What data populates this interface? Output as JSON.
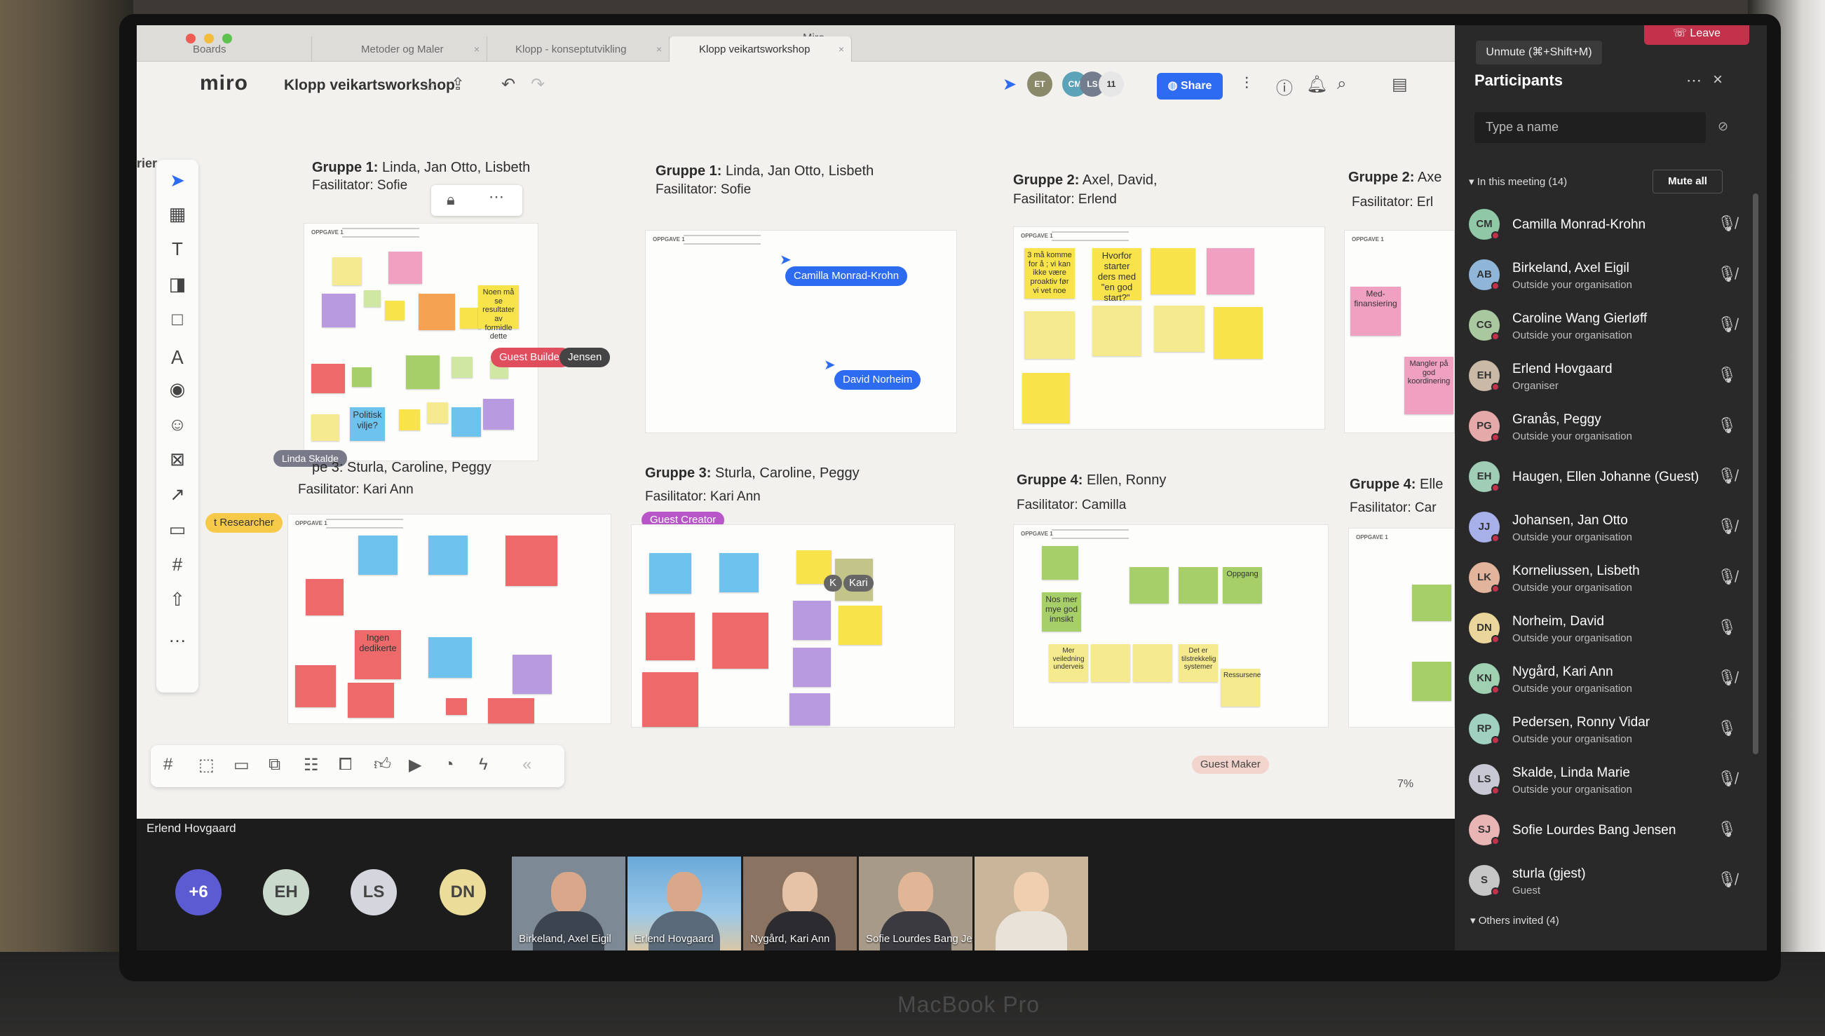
{
  "tabs": [
    "Boards",
    "Metoder og Maler",
    "Klopp - konseptutvikling",
    "Klopp veikartsworkshop"
  ],
  "window_title": "Miro",
  "miro": {
    "logo": "miro",
    "board_name": "Klopp veikartsworkshop",
    "avatars": [
      "ET",
      "CM",
      "LS",
      "11"
    ],
    "share_label": "Share",
    "zoom": "7%",
    "side_label": "rier"
  },
  "groups": [
    {
      "title_bold": "Gruppe 1:",
      "title_rest": " Linda, Jan Otto, Lisbeth",
      "fas": "Fasilitator: Sofie"
    },
    {
      "title_bold": "Gruppe 1:",
      "title_rest": " Linda, Jan Otto, Lisbeth",
      "fas": "Fasilitator: Sofie"
    },
    {
      "title_bold": "Gruppe 2:",
      "title_rest": " Axel, David,",
      "fas": "Fasilitator: Erlend"
    },
    {
      "title_bold": "Gruppe 2:",
      "title_rest": " Axe",
      "fas": "Fasilitator: Erl"
    },
    {
      "title_bold": "",
      "title_rest": "pe 3: Sturla, Caroline, Peggy",
      "fas": "Fasilitator: Kari Ann"
    },
    {
      "title_bold": "Gruppe 3:",
      "title_rest": " Sturla, Caroline, Peggy",
      "fas": "Fasilitator: Kari Ann"
    },
    {
      "title_bold": "Gruppe 4:",
      "title_rest": " Ellen, Ronny",
      "fas": "Fasilitator: Camilla"
    },
    {
      "title_bold": "Gruppe 4:",
      "title_rest": " Elle",
      "fas": "Fasilitator: Car"
    }
  ],
  "frame_tag": "OPPGAVE 1",
  "notes": {
    "politisk": "Politisk vilje?",
    "nosen": "Noen må se resultater av formidle dette",
    "hvorfor": "Hvorfor starter ders med \"en god start?\"",
    "tre_maa": "3 må komme for å ; vi kan ikke være proaktiv før vi vet noe",
    "med": "Med-finansiering",
    "mangler": "Mangler på god koordinering",
    "ingen": "Ingen dedikerte",
    "nos_mer": "Nos mer mye god innsikt",
    "mer": "Mer veiledning underveis",
    "oppgang": "Oppgang",
    "det_er": "Det er tilstrekkelig systemer",
    "ressurser": "Ressursene"
  },
  "cursors": {
    "guest_builder": "Guest Builder",
    "jensen": "Jensen",
    "camilla": "Camilla Monrad-Krohn",
    "david": "David Norheim",
    "linda": "Linda Skalde",
    "researcher": "t Researcher",
    "guest_creator": "Guest Creator",
    "kari": "Kari",
    "k": "K",
    "guest_maker": "Guest Maker"
  },
  "video": {
    "presenter": "Erlend Hovgaard",
    "more": "+6",
    "avatars": [
      "EH",
      "LS",
      "DN"
    ],
    "tiles": [
      "Birkeland, Axel Eigil",
      "Erlend Hovgaard",
      "Nygård, Kari Ann",
      "Sofie Lourdes Bang Jensen",
      ""
    ]
  },
  "teams": {
    "tooltip": "Unmute (⌘+Shift+M)",
    "leave": "Leave",
    "title": "Participants",
    "search_placeholder": "Type a name",
    "in_meeting": "In this meeting (14)",
    "mute_all": "Mute all",
    "others": "Others invited (4)",
    "participants": [
      {
        "initials": "CM",
        "name": "Camilla Monrad-Krohn",
        "sub": "",
        "color": "#8fc7a7",
        "muted": true
      },
      {
        "initials": "AB",
        "name": "Birkeland, Axel Eigil",
        "sub": "Outside your organisation",
        "color": "#8fb6d8",
        "muted": true
      },
      {
        "initials": "CG",
        "name": "Caroline Wang Gierløff",
        "sub": "Outside your organisation",
        "color": "#a9c8a0",
        "muted": true
      },
      {
        "initials": "EH",
        "name": "Erlend Hovgaard",
        "sub": "Organiser",
        "color": "#c9b9a6",
        "muted": false
      },
      {
        "initials": "PG",
        "name": "Granås, Peggy",
        "sub": "Outside your organisation",
        "color": "#e6a9a9",
        "muted": false
      },
      {
        "initials": "EH",
        "name": "Haugen, Ellen Johanne (Guest)",
        "sub": "",
        "color": "#9fcdb5",
        "muted": true
      },
      {
        "initials": "JJ",
        "name": "Johansen, Jan Otto",
        "sub": "Outside your organisation",
        "color": "#a7b0e8",
        "muted": true
      },
      {
        "initials": "LK",
        "name": "Korneliussen, Lisbeth",
        "sub": "Outside your organisation",
        "color": "#e3b49c",
        "muted": true
      },
      {
        "initials": "DN",
        "name": "Norheim, David",
        "sub": "Outside your organisation",
        "color": "#ead59a",
        "muted": false
      },
      {
        "initials": "KN",
        "name": "Nygård, Kari Ann",
        "sub": "Outside your organisation",
        "color": "#9fd0b2",
        "muted": true
      },
      {
        "initials": "RP",
        "name": "Pedersen, Ronny Vidar",
        "sub": "Outside your organisation",
        "color": "#9fd0c0",
        "muted": false
      },
      {
        "initials": "LS",
        "name": "Skalde, Linda Marie",
        "sub": "Outside your organisation",
        "color": "#c8c8d4",
        "muted": true
      },
      {
        "initials": "SJ",
        "name": "Sofie Lourdes Bang Jensen",
        "sub": "",
        "color": "#e8b4b4",
        "muted": false
      },
      {
        "initials": "S",
        "name": "sturla (gjest)",
        "sub": "Guest",
        "color": "#c6c6c6",
        "muted": true
      }
    ]
  }
}
